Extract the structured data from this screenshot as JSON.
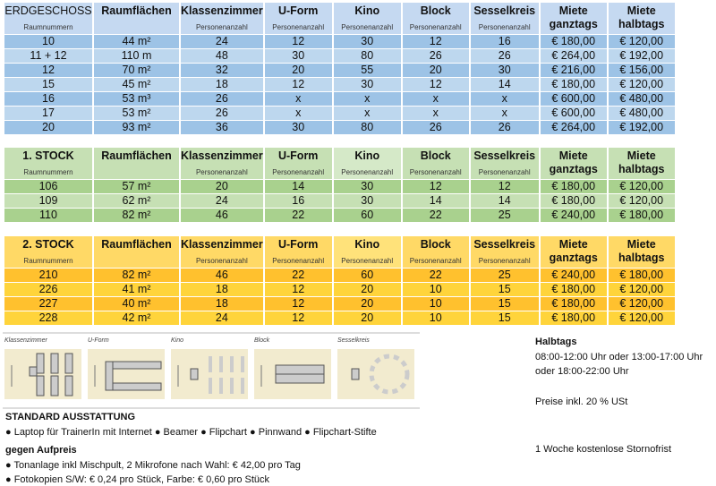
{
  "columns": [
    "Raumflächen",
    "Klassenzimmer",
    "U-Form",
    "Kino",
    "Block",
    "Sesselkreis"
  ],
  "sub_label": "Personenanzahl",
  "room_sub_label": "Raumnummern",
  "rent_full": [
    "Miete",
    "ganztags"
  ],
  "rent_half": [
    "Miete",
    "halbtags"
  ],
  "sections": [
    {
      "title": "ERDGESCHOSS",
      "rows": [
        [
          "10",
          "44 m²",
          "24",
          "12",
          "30",
          "12",
          "16",
          "€ 180,00",
          "€ 120,00"
        ],
        [
          "11 + 12",
          "110 m",
          "48",
          "30",
          "80",
          "26",
          "26",
          "€ 264,00",
          "€ 192,00"
        ],
        [
          "12",
          "70 m²",
          "32",
          "20",
          "55",
          "20",
          "30",
          "€ 216,00",
          "€ 156,00"
        ],
        [
          "15",
          "45 m²",
          "18",
          "12",
          "30",
          "12",
          "14",
          "€ 180,00",
          "€ 120,00"
        ],
        [
          "16",
          "53 m³",
          "26",
          "x",
          "x",
          "x",
          "x",
          "€ 600,00",
          "€ 480,00"
        ],
        [
          "17",
          "53 m²",
          "26",
          "x",
          "x",
          "x",
          "x",
          "€ 600,00",
          "€ 480,00"
        ],
        [
          "20",
          "93 m²",
          "36",
          "30",
          "80",
          "26",
          "26",
          "€ 264,00",
          "€ 192,00"
        ]
      ]
    },
    {
      "title": "1. STOCK",
      "rows": [
        [
          "106",
          "57 m²",
          "20",
          "14",
          "30",
          "12",
          "12",
          "€ 180,00",
          "€ 120,00"
        ],
        [
          "109",
          "62 m²",
          "24",
          "16",
          "30",
          "14",
          "14",
          "€ 180,00",
          "€ 120,00"
        ],
        [
          "110",
          "82 m²",
          "46",
          "22",
          "60",
          "22",
          "25",
          "€ 240,00",
          "€ 180,00"
        ]
      ]
    },
    {
      "title": "2. STOCK",
      "rows": [
        [
          "210",
          "82 m²",
          "46",
          "22",
          "60",
          "22",
          "25",
          "€ 240,00",
          "€ 180,00"
        ],
        [
          "226",
          "41 m²",
          "18",
          "12",
          "20",
          "10",
          "15",
          "€ 180,00",
          "€ 120,00"
        ],
        [
          "227",
          "40 m²",
          "18",
          "12",
          "20",
          "10",
          "15",
          "€ 180,00",
          "€ 120,00"
        ],
        [
          "228",
          "42 m²",
          "24",
          "12",
          "20",
          "10",
          "15",
          "€ 180,00",
          "€ 120,00"
        ]
      ]
    }
  ],
  "colors": {
    "blue": "#9dc3e6",
    "green": "#a9d18e",
    "yellow": "#ffc12e",
    "layout_bg": "#f2ebcf"
  },
  "layouts": [
    "Klassenzimmer",
    "U-Form",
    "Kino",
    "Block",
    "Sesselkreis"
  ],
  "info": {
    "halbtags_title": "Halbtags",
    "halbtags_line1": "08:00-12:00 Uhr oder 13:00-17:00 Uhr",
    "halbtags_line2": "oder 18:00-22:00 Uhr",
    "prices": "Preise inkl. 20 % USt",
    "storno": "1 Woche kostenlose Stornofrist"
  },
  "standard": {
    "title": "STANDARD AUSSTATTUNG",
    "items": "● Laptop für TrainerIn mit Internet ● Beamer ● Flipchart ● Pinnwand ● Flipchart-Stifte"
  },
  "extra": {
    "title": "gegen Aufpreis",
    "item1": "● Tonanlage inkl Mischpult, 2 Mikrofone nach Wahl: € 42,00 pro Tag",
    "item2": "● Fotokopien S/W: € 0,24 pro Stück, Farbe: € 0,60 pro Stück"
  }
}
